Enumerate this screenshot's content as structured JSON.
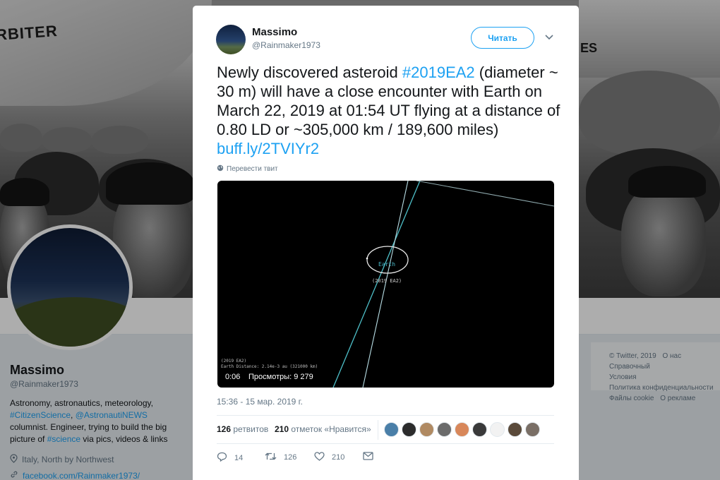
{
  "background": {
    "banner_text_left": "RBITER",
    "banner_text_left_2": "E",
    "banner_text_right": "ES"
  },
  "profile": {
    "name": "Massimo",
    "handle": "@Rainmaker1973",
    "bio": {
      "line1": "Astronomy, astronautics, meteorology,",
      "tag1": "#CitizenScience",
      "sep1": ", ",
      "tag2": "@AstronautiNEWS",
      "line3": "columnist. Engineer, trying to build the big",
      "line4_prefix": "picture of ",
      "tag3": "#science",
      "line4_suffix": " via pics, videos & links"
    },
    "location": "Italy, North by Northwest",
    "website": "facebook.com/Rainmaker1973/"
  },
  "footer": {
    "items_row1": [
      "© Twitter, 2019",
      "О нас",
      "Справочный"
    ],
    "items_row2": [
      "Условия",
      "Политика конфиденциальности"
    ],
    "items_row3": [
      "Файлы cookie",
      "О рекламе"
    ]
  },
  "tweet": {
    "author_name": "Massimo",
    "author_handle": "@Rainmaker1973",
    "follow_label": "Читать",
    "text_part1": "Newly discovered asteroid ",
    "hashtag": "#2019EA2",
    "text_part2": " (diameter ~ 30 m) will have a close encounter with Earth on March 22, 2019 at 01:54 UT flying at a distance of 0.80 LD or ~305,000 km / 189,600 miles) ",
    "link": "buff.ly/2TVIYr2",
    "translate_label": "Перевести твит",
    "media": {
      "earth_label": "Earth",
      "asteroid_label": "(2019 EA2)",
      "info_line1": "(2019 EA2)",
      "info_line2": "Earth Distance: 2.14e-3 au (321000 km)",
      "duration": "0:06",
      "views": "Просмотры: 9 279"
    },
    "timestamp": "15:36 - 15 мар. 2019 г.",
    "retweet_count": "126",
    "retweet_label": " ретвитов",
    "like_count": "210",
    "like_label": " отметок «Нравится»",
    "actions": {
      "reply_count": "14",
      "retweet_count": "126",
      "like_count": "210"
    },
    "liker_colors": [
      "#4a7fa8",
      "#2c2c2c",
      "#b08a62",
      "#6b6b6b",
      "#d8875a",
      "#3a3a3a",
      "#f2f2f2",
      "#5a4a3a",
      "#7a6f66"
    ]
  },
  "colors": {
    "accent": "#1da1f2",
    "text": "#14171a",
    "secondary": "#657786"
  }
}
